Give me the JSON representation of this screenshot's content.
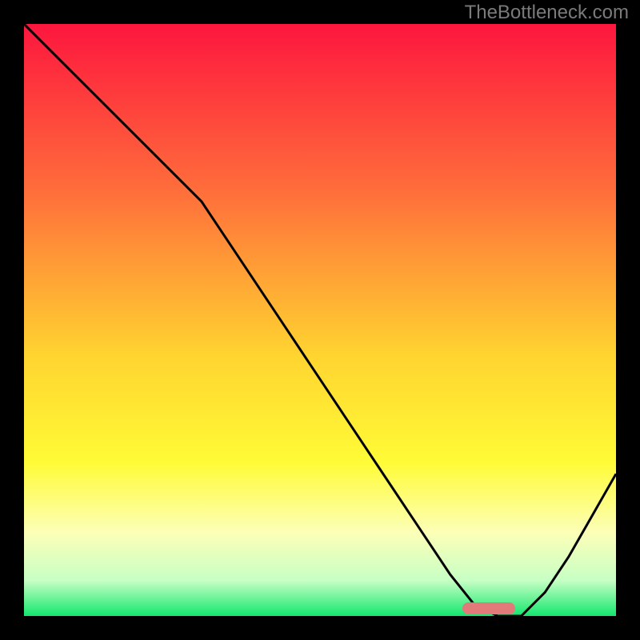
{
  "watermark": "TheBottleneck.com",
  "colors": {
    "top": "#fd163e",
    "mid1": "#ff6d3b",
    "mid2": "#ffd430",
    "mid3": "#fffb36",
    "mid4": "#fcffb8",
    "low1": "#c7ffc4",
    "bottom": "#14e76f",
    "curve": "#000000",
    "marker": "#e17a79",
    "frame": "#000000"
  },
  "chart_data": {
    "type": "line",
    "title": "",
    "xlabel": "",
    "ylabel": "",
    "xlim": [
      0,
      100
    ],
    "ylim": [
      0,
      100
    ],
    "series": [
      {
        "name": "curve",
        "x": [
          0,
          6,
          12,
          18,
          24,
          30,
          36,
          42,
          48,
          54,
          60,
          66,
          72,
          76,
          80,
          84,
          88,
          92,
          96,
          100
        ],
        "y": [
          100,
          94,
          88,
          82,
          76,
          70,
          61,
          52,
          43,
          34,
          25,
          16,
          7,
          2,
          0,
          0,
          4,
          10,
          17,
          24
        ]
      }
    ],
    "marker": {
      "x_start": 74,
      "x_end": 83,
      "y": 1.3
    }
  }
}
